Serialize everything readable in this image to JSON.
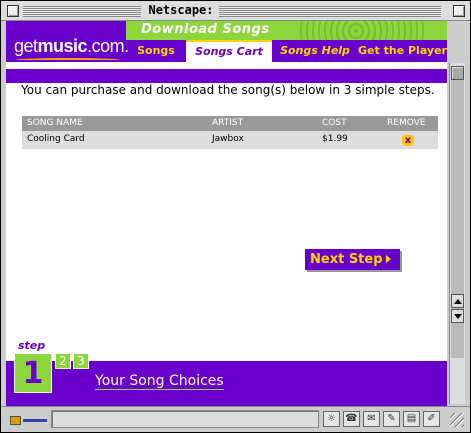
{
  "window": {
    "title": "Netscape:"
  },
  "header": {
    "title": "Download Songs",
    "logo_light": "get",
    "logo_bold": "music",
    "logo_suffix": ".com.",
    "tabs": [
      {
        "label": "Songs",
        "active": false
      },
      {
        "label": "Songs Cart",
        "active": true
      },
      {
        "label": "Songs Help",
        "active": false
      },
      {
        "label": "Get the Player",
        "active": false
      }
    ]
  },
  "main": {
    "intro": "You can purchase and download the song(s) below in 3 simple steps.",
    "table": {
      "columns": [
        "SONG NAME",
        "ARTIST",
        "COST",
        "REMOVE"
      ],
      "rows": [
        {
          "song": "Cooling Card",
          "artist": "Jawbox",
          "cost": "$1.99",
          "remove": "x"
        }
      ]
    },
    "next_button": "Next Step"
  },
  "steps": {
    "label": "step",
    "current": "1",
    "others": [
      "2",
      "3"
    ],
    "title": "Your Song Choices"
  },
  "colors": {
    "purple": "#6a00cc",
    "green": "#8ed63e",
    "yellow": "#ffd400"
  },
  "statusbar": {
    "icons": [
      "bookmark-icon",
      "network-icon",
      "mail-icon",
      "composer-icon",
      "news-icon",
      "edit-icon"
    ]
  }
}
